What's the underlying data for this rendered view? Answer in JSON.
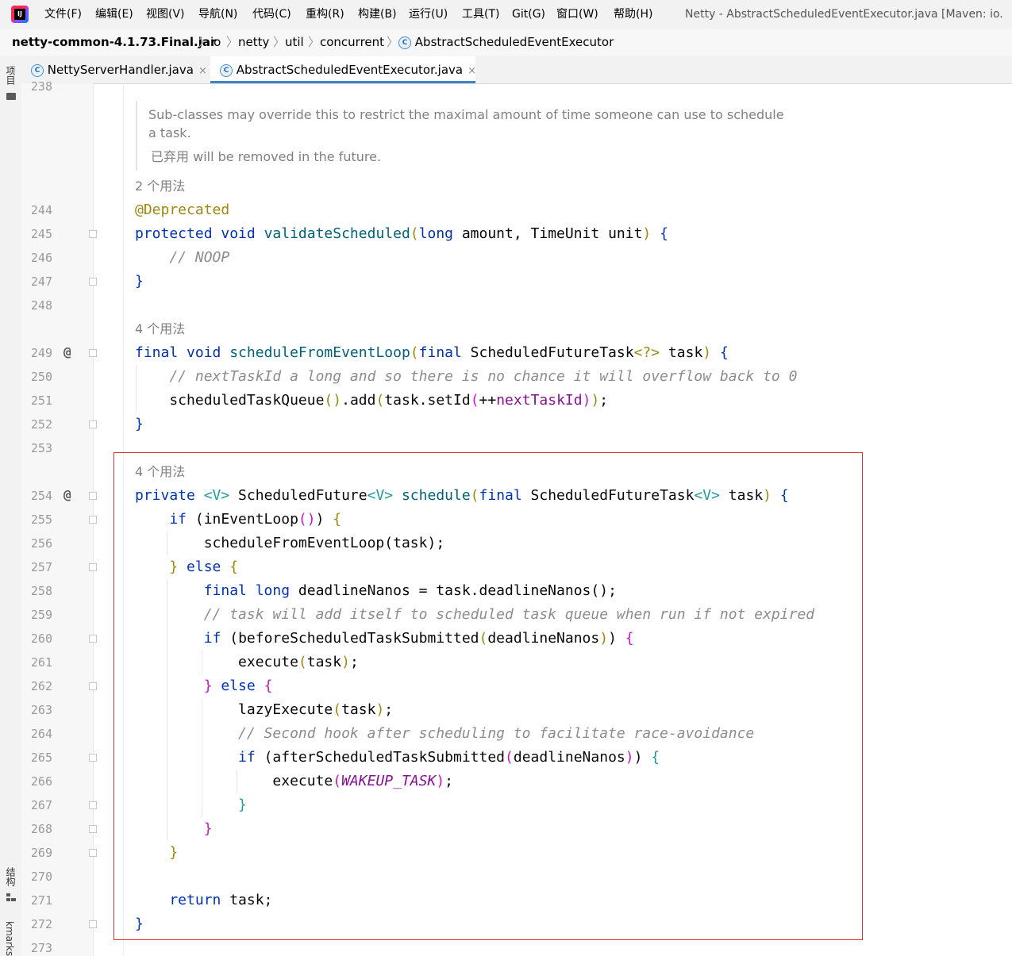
{
  "menubar": {
    "items": [
      "文件(F)",
      "编辑(E)",
      "视图(V)",
      "导航(N)",
      "代码(C)",
      "重构(R)",
      "构建(B)",
      "运行(U)",
      "工具(T)",
      "Git(G)",
      "窗口(W)",
      "帮助(H)"
    ],
    "window_title": "Netty - AbstractScheduledEventExecutor.java [Maven: io."
  },
  "breadcrumb": {
    "jar": "netty-common-4.1.73.Final.jar",
    "p1": "io",
    "p2": "netty",
    "p3": "util",
    "p4": "concurrent",
    "cls": "AbstractScheduledEventExecutor",
    "cicon": "C"
  },
  "toolwindows": {
    "project": "项目",
    "structure": "结构",
    "bookmarks": "kmarks"
  },
  "tabs": [
    {
      "label": "NettyServerHandler.java",
      "close": "×"
    },
    {
      "label": "AbstractScheduledEventExecutor.java",
      "close": "×"
    }
  ],
  "gutter": {
    "lines": [
      "238",
      "244",
      "245",
      "246",
      "247",
      "248",
      "249",
      "250",
      "251",
      "252",
      "253",
      "254",
      "255",
      "256",
      "257",
      "258",
      "259",
      "260",
      "261",
      "262",
      "263",
      "264",
      "265",
      "266",
      "267",
      "268",
      "269",
      "270",
      "271",
      "272",
      "273"
    ],
    "override_marker": "@"
  },
  "doc": {
    "line1": "Sub-classes may override this to restrict the maximal amount of time someone can use to schedule",
    "line2": "a task.",
    "deprecated_label": "已弃用",
    "deprecated_text": " will be removed in the future."
  },
  "usages": {
    "u1": "2 个用法",
    "u2": "4 个用法",
    "u3": "4 个用法"
  },
  "code": {
    "ann": "@Deprecated",
    "l245a": "protected void ",
    "l245b": "validateScheduled",
    "l245c": "(",
    "l245d": "long",
    "l245e": " amount, TimeUnit unit",
    "l245f": ")",
    "l245g": " {",
    "l246": "    // NOOP",
    "l247": "}",
    "l249a": "final void ",
    "l249b": "scheduleFromEventLoop",
    "l249c": "(",
    "l249d": "final",
    "l249e": " ScheduledFutureTask",
    "l249f": "<?>",
    "l249g": " task",
    "l249h": ")",
    "l249i": " {",
    "l250": "    // nextTaskId a long and so there is no chance it will overflow back to 0",
    "l251a": "    scheduledTaskQueue",
    "l251b": "()",
    "l251c": ".add",
    "l251d": "(",
    "l251e": "task.setId",
    "l251f": "(",
    "l251g": "++",
    "l251h": "nextTaskId",
    "l251i": ")",
    "l251j": ")",
    "l251k": ";",
    "l252": "}",
    "l254a": "private ",
    "l254b": "<V>",
    "l254c": " ScheduledFuture",
    "l254d": "<V>",
    "l254e": " ",
    "l254f": "schedule",
    "l254g": "(",
    "l254h": "final",
    "l254i": " ScheduledFutureTask",
    "l254j": "<V>",
    "l254k": " task",
    "l254l": ")",
    "l254m": " {",
    "l255a": "    if ",
    "l255b": "(",
    "l255c": "inEventLoop",
    "l255d": "()",
    "l255e": ")",
    "l255f": " {",
    "l256a": "        scheduleFromEventLoop",
    "l256b": "(",
    "l256c": "task",
    "l256d": ")",
    "l256e": ";",
    "l257a": "    }",
    "l257b": " else ",
    "l257c": "{",
    "l258a": "        final long",
    "l258b": " deadlineNanos = task.deadlineNanos",
    "l258c": "()",
    "l258d": ";",
    "l259": "        // task will add itself to scheduled task queue when run if not expired",
    "l260a": "        if ",
    "l260b": "(",
    "l260c": "beforeScheduledTaskSubmitted",
    "l260d": "(",
    "l260e": "deadlineNanos",
    "l260f": ")",
    "l260g": ")",
    "l260h": " {",
    "l261a": "            execute",
    "l261b": "(",
    "l261c": "task",
    "l261d": ")",
    "l261e": ";",
    "l262a": "        }",
    "l262b": " else ",
    "l262c": "{",
    "l263a": "            lazyExecute",
    "l263b": "(",
    "l263c": "task",
    "l263d": ")",
    "l263e": ";",
    "l264": "            // Second hook after scheduling to facilitate race-avoidance",
    "l265a": "            if ",
    "l265b": "(",
    "l265c": "afterScheduledTaskSubmitted",
    "l265d": "(",
    "l265e": "deadlineNanos",
    "l265f": ")",
    "l265g": ")",
    "l265h": " {",
    "l266a": "                execute",
    "l266b": "(",
    "l266c": "WAKEUP_TASK",
    "l266d": ")",
    "l266e": ";",
    "l267": "            }",
    "l268": "        }",
    "l269": "    }",
    "l271a": "    return",
    "l271b": " task;",
    "l272": "}"
  },
  "colors": {
    "accent_tab": "#4083c9",
    "highlight_box": "#d9332e",
    "keyword": "#0033b3",
    "annotation": "#9e880d",
    "comment": "#8c8c8c",
    "field": "#871094"
  }
}
